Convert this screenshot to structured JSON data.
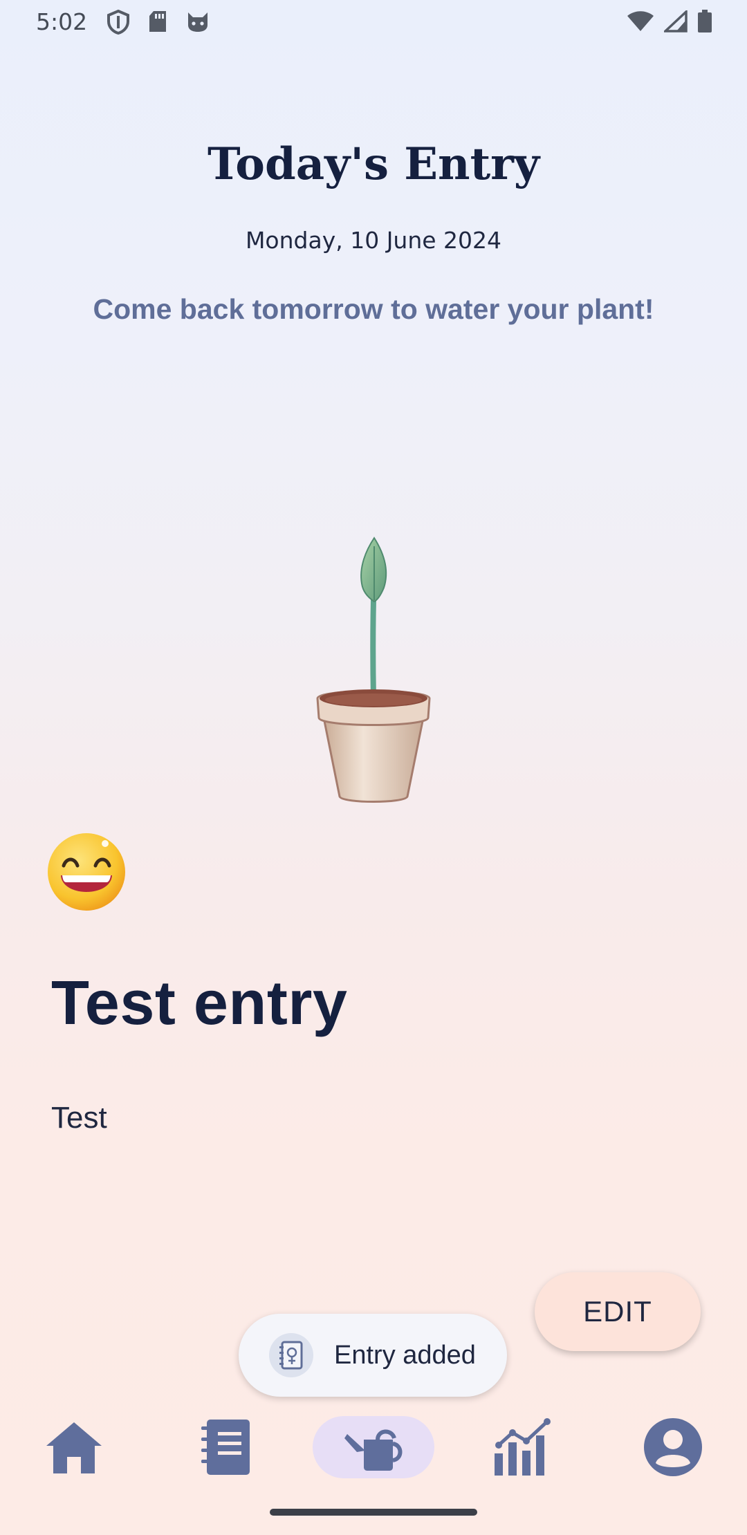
{
  "status_bar": {
    "time": "5:02",
    "left_icons": [
      "shield-icon",
      "sd-card-icon",
      "cat-face-icon"
    ],
    "right_icons": [
      "wifi-icon",
      "cell-signal-icon",
      "battery-icon"
    ]
  },
  "header": {
    "title": "Today's Entry",
    "date": "Monday, 10 June 2024",
    "reminder": "Come back tomorrow to water your plant!"
  },
  "plant": {
    "icon": "potted-sprout-icon"
  },
  "entry": {
    "mood_icon": "grinning-face-emoji",
    "title": "Test entry",
    "body": "Test"
  },
  "actions": {
    "edit_label": "EDIT"
  },
  "toast": {
    "icon": "journal-book-icon",
    "message": "Entry added"
  },
  "bottom_nav": {
    "items": [
      {
        "icon": "home-icon",
        "active": false
      },
      {
        "icon": "notebook-icon",
        "active": false
      },
      {
        "icon": "watering-can-icon",
        "active": true
      },
      {
        "icon": "bar-chart-icon",
        "active": false
      },
      {
        "icon": "profile-icon",
        "active": false
      }
    ]
  },
  "colors": {
    "accent": "#5f6e98",
    "nav_icon": "#5f6e9c",
    "nav_active_bg": "#e7def6",
    "edit_button_bg": "#fde3da",
    "title_text": "#15203f"
  }
}
